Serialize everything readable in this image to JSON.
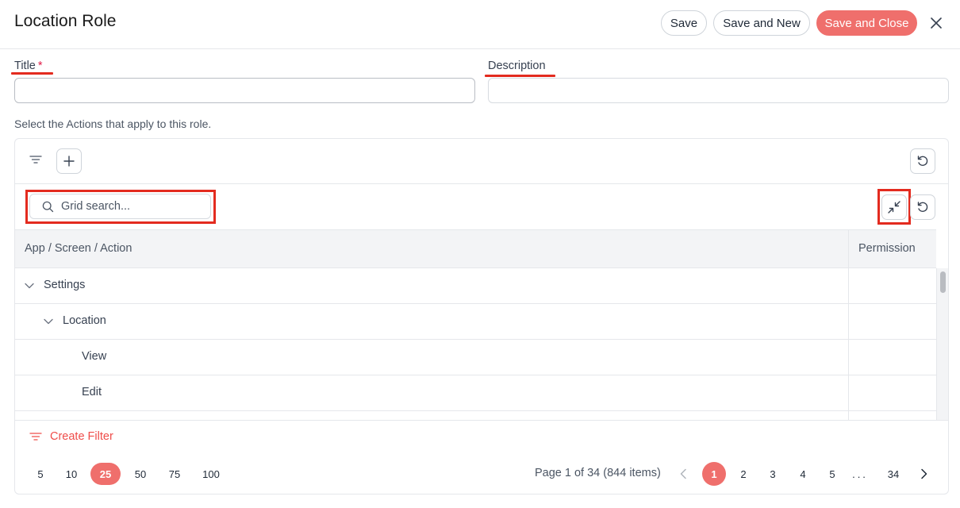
{
  "header": {
    "title": "Location Role",
    "save_label": "Save",
    "save_new_label": "Save and New",
    "save_close_label": "Save and Close"
  },
  "form": {
    "title_label": "Title",
    "title_required_mark": "*",
    "title_value": "",
    "description_label": "Description",
    "description_value": "",
    "hint": "Select the Actions that apply to this role."
  },
  "grid": {
    "search_placeholder": "Grid search...",
    "columns": [
      "App / Screen / Action",
      "Permission"
    ],
    "rows": [
      {
        "label": "Settings",
        "level": 0,
        "expandable": true,
        "expanded": true
      },
      {
        "label": "Location",
        "level": 1,
        "expandable": true,
        "expanded": true
      },
      {
        "label": "View",
        "level": 2,
        "expandable": false
      },
      {
        "label": "Edit",
        "level": 2,
        "expandable": false
      }
    ],
    "create_filter_label": "Create Filter"
  },
  "pagination": {
    "page_sizes": [
      "5",
      "10",
      "25",
      "50",
      "75",
      "100"
    ],
    "active_page_size": "25",
    "info": "Page 1 of 34 (844 items)",
    "pages": [
      "1",
      "2",
      "3",
      "4",
      "5",
      "...",
      "34"
    ],
    "active_page": "1"
  },
  "icons": {
    "close": "close-icon",
    "filter": "filter-lines-icon",
    "add": "plus-icon",
    "reset": "reset-icon",
    "collapse": "collapse-arrows-icon",
    "search": "search-icon",
    "chevron": "chevron-down-icon",
    "prev": "chevron-left-icon",
    "next": "chevron-right-icon"
  },
  "colors": {
    "accent": "#ef6f6c",
    "highlight": "#e32b1f",
    "header_bg": "#f3f4f6"
  }
}
